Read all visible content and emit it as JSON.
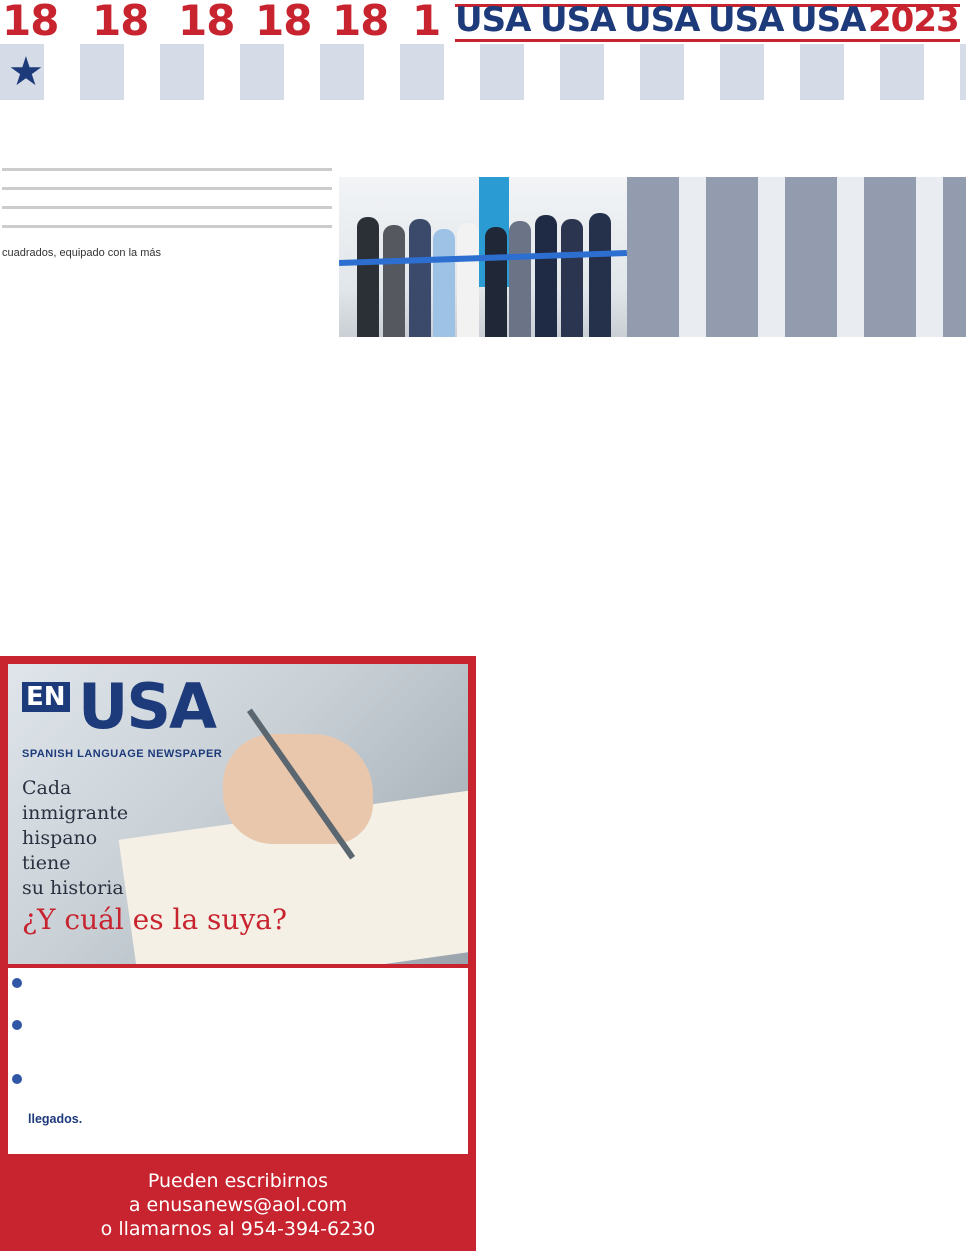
{
  "masthead": {
    "issue_numbers": [
      "18",
      "18",
      "18",
      "18",
      "18",
      "1"
    ],
    "usa_words": [
      "USA",
      "USA",
      "USA",
      "USA",
      "USA"
    ],
    "year": "2023"
  },
  "article": {
    "lead_fragment": "cuadrados, equipado con la más"
  },
  "ad": {
    "logo_en": "EN",
    "logo_usa": "USA",
    "logo_subtitle": "SPANISH LANGUAGE NEWSPAPER",
    "story_lines": [
      "Cada",
      "inmigrante",
      "hispano",
      "tiene",
      "su historia"
    ],
    "question": "¿Y cuál es la suya?",
    "list_tail": "llegados.",
    "contact_lines": [
      "Pueden escribirnos",
      "a enusanews@aol.com",
      "o llamarnos al 954-394-6230"
    ]
  },
  "colors": {
    "brand_red": "#c8242f",
    "brand_blue": "#1d3a7a",
    "accent_blue": "#2f57a6"
  },
  "icons": [
    "star-icon",
    "bullet-icon"
  ]
}
